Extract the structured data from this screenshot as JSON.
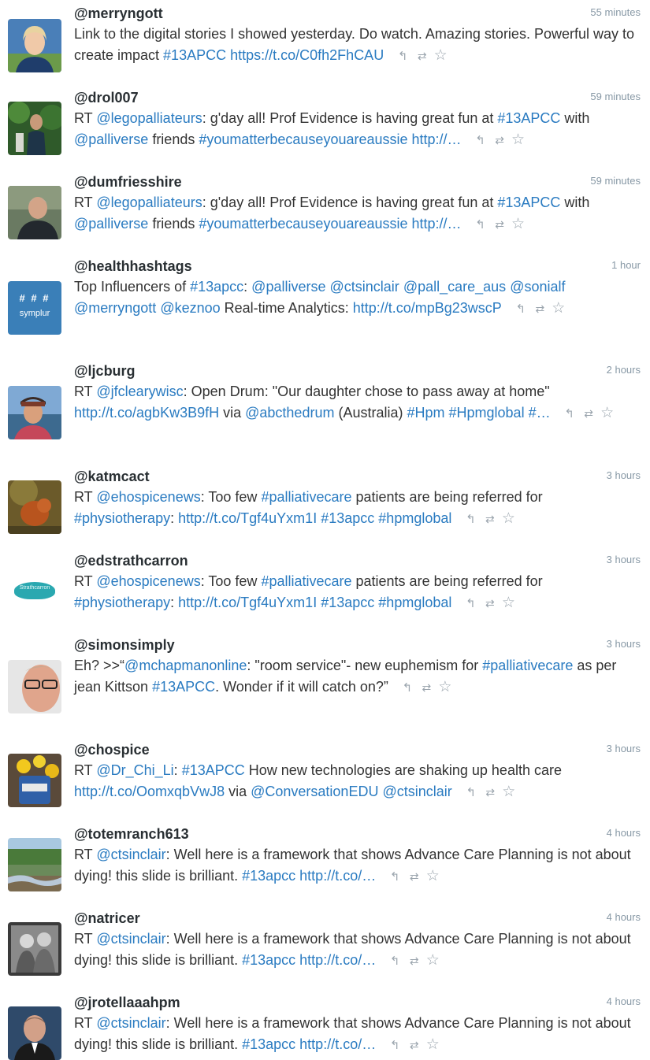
{
  "actions": {
    "reply_icon": "reply-icon",
    "retweet_icon": "retweet-icon",
    "favorite_icon": "favorite-icon",
    "reply_glyph": "↰",
    "retweet_glyph": "⇄",
    "favorite_glyph": "☆"
  },
  "colors": {
    "link": "#2a7bc1",
    "text": "#333333",
    "time": "#8899a6",
    "handle": "#292f33"
  },
  "tweets": [
    {
      "handle": "@merryngott",
      "time": "55 minutes",
      "segments": [
        {
          "t": "Link to the digital stories I showed yesterday. Do watch. Amazing stories. Powerful way to create impact "
        },
        {
          "t": "#13APCC",
          "link": true
        },
        {
          "t": " "
        },
        {
          "t": "https://t.co/C0fh2FhCAU",
          "link": true
        }
      ]
    },
    {
      "handle": "@drol007",
      "time": "59 minutes",
      "segments": [
        {
          "t": "RT "
        },
        {
          "t": "@legopalliateurs",
          "link": true
        },
        {
          "t": ": g'day all! Prof Evidence is having great fun at "
        },
        {
          "t": "#13APCC",
          "link": true
        },
        {
          "t": " with "
        },
        {
          "t": "@palliverse",
          "link": true
        },
        {
          "t": " friends "
        },
        {
          "t": "#youmatterbecauseyouareaussie",
          "link": true
        },
        {
          "t": " "
        },
        {
          "t": "http://…",
          "link": true
        }
      ]
    },
    {
      "handle": "@dumfriesshire",
      "time": "59 minutes",
      "segments": [
        {
          "t": "RT "
        },
        {
          "t": "@legopalliateurs",
          "link": true
        },
        {
          "t": ": g'day all! Prof Evidence is having great fun at "
        },
        {
          "t": "#13APCC",
          "link": true
        },
        {
          "t": " with "
        },
        {
          "t": "@palliverse",
          "link": true
        },
        {
          "t": " friends "
        },
        {
          "t": "#youmatterbecauseyouareaussie",
          "link": true
        },
        {
          "t": " "
        },
        {
          "t": "http://…",
          "link": true
        }
      ]
    },
    {
      "handle": "@healthhashtags",
      "time": "1 hour",
      "avatar_text": "symplur",
      "avatar_marks": "# # #",
      "segments": [
        {
          "t": "Top Influencers of "
        },
        {
          "t": "#13apcc",
          "link": true
        },
        {
          "t": ": "
        },
        {
          "t": "@palliverse",
          "link": true
        },
        {
          "t": " "
        },
        {
          "t": "@ctsinclair",
          "link": true
        },
        {
          "t": " "
        },
        {
          "t": "@pall_care_aus",
          "link": true
        },
        {
          "t": " "
        },
        {
          "t": "@sonialf",
          "link": true
        },
        {
          "t": " "
        },
        {
          "t": "@merryngott",
          "link": true
        },
        {
          "t": " "
        },
        {
          "t": "@keznoo",
          "link": true
        },
        {
          "t": " Real-time Analytics: "
        },
        {
          "t": "http://t.co/mpBg23wscP",
          "link": true
        }
      ]
    },
    {
      "handle": "@ljcburg",
      "time": "2 hours",
      "segments": [
        {
          "t": "RT "
        },
        {
          "t": "@jfclearywisc",
          "link": true
        },
        {
          "t": ": Open Drum: \"Our daughter chose to pass away at home\" "
        },
        {
          "t": "http://t.co/agbKw3B9fH",
          "link": true
        },
        {
          "t": " via "
        },
        {
          "t": "@abcthedrum",
          "link": true
        },
        {
          "t": " (Australia) "
        },
        {
          "t": "#Hpm",
          "link": true
        },
        {
          "t": " "
        },
        {
          "t": "#Hpmglobal",
          "link": true
        },
        {
          "t": " "
        },
        {
          "t": "#…",
          "link": true
        }
      ]
    },
    {
      "handle": "@katmcact",
      "time": "3 hours",
      "segments": [
        {
          "t": "RT "
        },
        {
          "t": "@ehospicenews",
          "link": true
        },
        {
          "t": ": Too few "
        },
        {
          "t": "#palliativecare",
          "link": true
        },
        {
          "t": " patients are being referred for "
        },
        {
          "t": "#physiotherapy",
          "link": true
        },
        {
          "t": ": "
        },
        {
          "t": "http://t.co/Tgf4uYxm1I",
          "link": true
        },
        {
          "t": " "
        },
        {
          "t": "#13apcc",
          "link": true
        },
        {
          "t": " "
        },
        {
          "t": "#hpmglobal",
          "link": true
        }
      ]
    },
    {
      "handle": "@edstrathcarron",
      "time": "3 hours",
      "avatar_text": "Strathcarron",
      "segments": [
        {
          "t": "RT "
        },
        {
          "t": "@ehospicenews",
          "link": true
        },
        {
          "t": ": Too few "
        },
        {
          "t": "#palliativecare",
          "link": true
        },
        {
          "t": " patients are being referred for "
        },
        {
          "t": "#physiotherapy",
          "link": true
        },
        {
          "t": ": "
        },
        {
          "t": "http://t.co/Tgf4uYxm1I",
          "link": true
        },
        {
          "t": " "
        },
        {
          "t": "#13apcc",
          "link": true
        },
        {
          "t": " "
        },
        {
          "t": "#hpmglobal",
          "link": true
        }
      ]
    },
    {
      "handle": "@simonsimply",
      "time": "3 hours",
      "segments": [
        {
          "t": "Eh? >>“"
        },
        {
          "t": "@mchapmanonline",
          "link": true
        },
        {
          "t": ": \"room service\"- new euphemism for "
        },
        {
          "t": "#palliativecare",
          "link": true
        },
        {
          "t": " as per jean Kittson "
        },
        {
          "t": "#13APCC",
          "link": true
        },
        {
          "t": ". Wonder if it will catch on?”"
        }
      ]
    },
    {
      "handle": "@chospice",
      "time": "3 hours",
      "segments": [
        {
          "t": "RT "
        },
        {
          "t": "@Dr_Chi_Li",
          "link": true
        },
        {
          "t": ": "
        },
        {
          "t": "#13APCC",
          "link": true
        },
        {
          "t": " How new technologies are shaking up health care "
        },
        {
          "t": "http://t.co/OomxqbVwJ8",
          "link": true
        },
        {
          "t": " via "
        },
        {
          "t": "@ConversationEDU",
          "link": true
        },
        {
          "t": " "
        },
        {
          "t": "@ctsinclair",
          "link": true
        }
      ]
    },
    {
      "handle": "@totemranch613",
      "time": "4 hours",
      "segments": [
        {
          "t": "RT "
        },
        {
          "t": "@ctsinclair",
          "link": true
        },
        {
          "t": ": Well here is a framework that shows Advance Care Planning is not about dying! this slide is brilliant. "
        },
        {
          "t": "#13apcc",
          "link": true
        },
        {
          "t": " "
        },
        {
          "t": "http://t.co/…",
          "link": true
        }
      ]
    },
    {
      "handle": "@natricer",
      "time": "4 hours",
      "segments": [
        {
          "t": "RT "
        },
        {
          "t": "@ctsinclair",
          "link": true
        },
        {
          "t": ": Well here is a framework that shows Advance Care Planning is not about dying! this slide is brilliant. "
        },
        {
          "t": "#13apcc",
          "link": true
        },
        {
          "t": " "
        },
        {
          "t": "http://t.co/…",
          "link": true
        }
      ]
    },
    {
      "handle": "@jrotellaaahpm",
      "time": "4 hours",
      "segments": [
        {
          "t": "RT "
        },
        {
          "t": "@ctsinclair",
          "link": true
        },
        {
          "t": ": Well here is a framework that shows Advance Care Planning is not about dying! this slide is brilliant. "
        },
        {
          "t": "#13apcc",
          "link": true
        },
        {
          "t": " "
        },
        {
          "t": "http://t.co/…",
          "link": true
        }
      ]
    }
  ]
}
